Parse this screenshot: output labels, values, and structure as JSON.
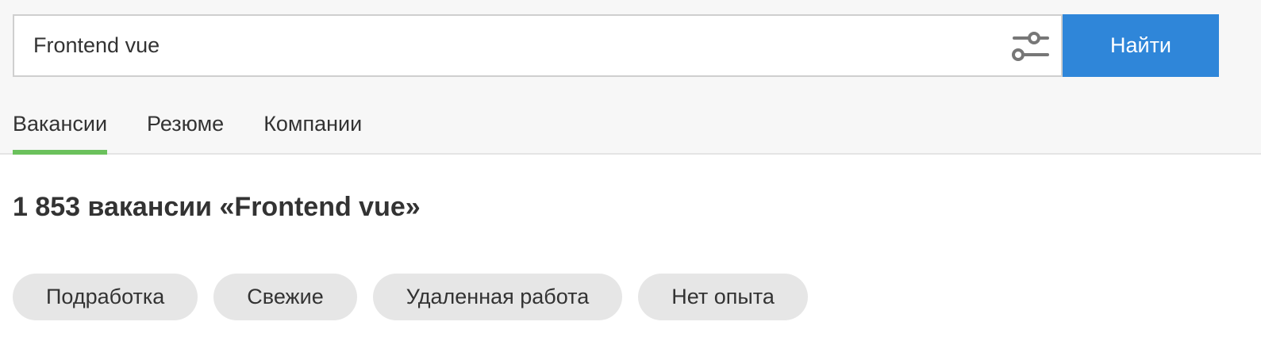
{
  "search": {
    "value": "Frontend vue",
    "filter_icon": "sliders-icon",
    "button_label": "Найти"
  },
  "tabs": [
    {
      "label": "Вакансии",
      "active": true
    },
    {
      "label": "Резюме",
      "active": false
    },
    {
      "label": "Компании",
      "active": false
    }
  ],
  "results": {
    "title": "1 853 вакансии «Frontend vue»"
  },
  "chips": [
    {
      "label": "Подработка"
    },
    {
      "label": "Свежие"
    },
    {
      "label": "Удаленная работа"
    },
    {
      "label": "Нет опыта"
    }
  ],
  "colors": {
    "accent_button": "#2f86d9",
    "active_tab_underline": "#6bc15c",
    "top_background": "#f7f7f7",
    "chip_background": "#e6e6e6"
  }
}
